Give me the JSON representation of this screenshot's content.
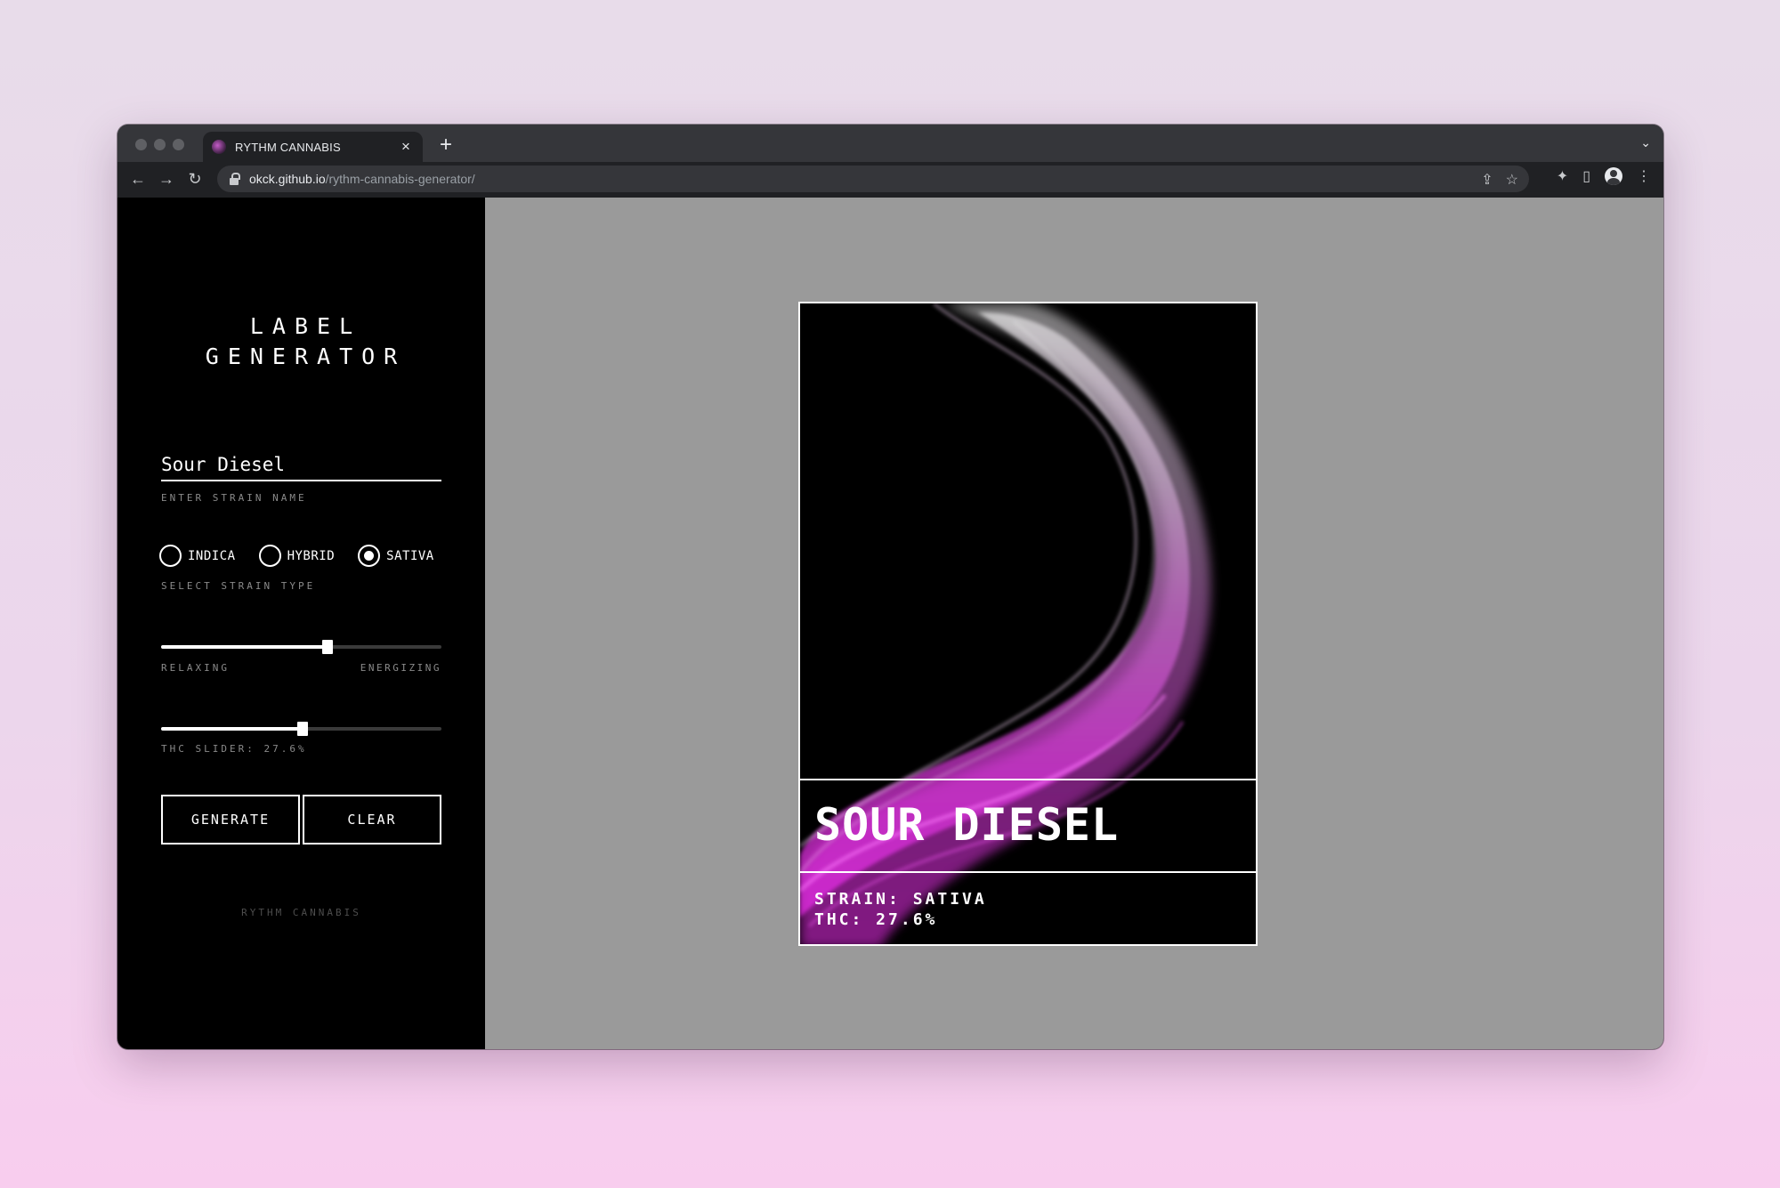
{
  "browser": {
    "tab_title": "RYTHM CANNABIS",
    "tab_close": "×",
    "new_tab": "+",
    "tab_menu": "⌄",
    "url_host": "okck.github.io",
    "url_path": "/rythm-cannabis-generator/"
  },
  "sidebar": {
    "title_line1": "LABEL",
    "title_line2": "GENERATOR",
    "strain_name_value": "Sour Diesel",
    "strain_name_caption": "ENTER STRAIN NAME",
    "strain_types": [
      {
        "label": "INDICA",
        "selected": false
      },
      {
        "label": "HYBRID",
        "selected": false
      },
      {
        "label": "SATIVA",
        "selected": true
      }
    ],
    "strain_type_caption": "SELECT STRAIN TYPE",
    "effect_slider": {
      "value": 0.595,
      "min_label": "RELAXING",
      "max_label": "ENERGIZING"
    },
    "thc_slider": {
      "value": 0.505,
      "caption": "THC SLIDER: 27.6%"
    },
    "generate_label": "GENERATE",
    "clear_label": "CLEAR",
    "footer": "RYTHM CANNABIS"
  },
  "label_card": {
    "strain_name": "SOUR DIESEL",
    "strain_line": "STRAIN: SATIVA",
    "thc_line": "THC: 27.6%"
  },
  "colors": {
    "accent": "#e02fe0",
    "sidebar_bg": "#000000",
    "canvas_bg": "#9a9a9a"
  }
}
